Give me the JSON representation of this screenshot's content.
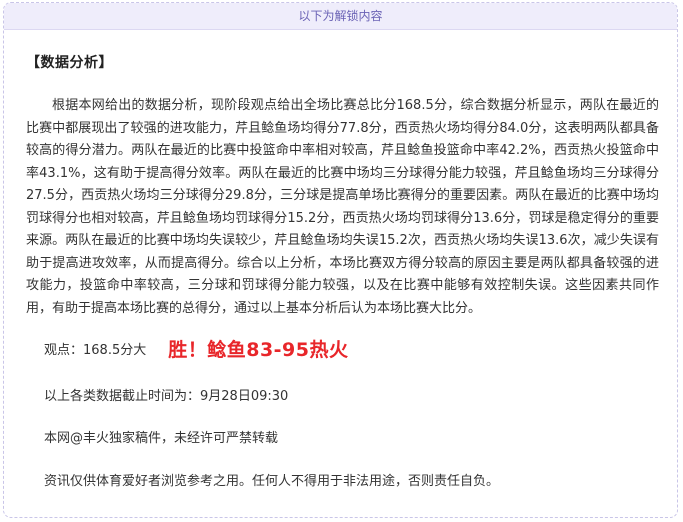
{
  "unlock_banner": "以下为解锁内容",
  "section_title": "【数据分析】",
  "analysis_text": "根据本网给出的数据分析，现阶段观点给出全场比赛总比分168.5分，综合数据分析显示，两队在最近的比赛中都展现出了较强的进攻能力，芹且鲶鱼场均得分77.8分，西贡热火场均得分84.0分，这表明两队都具备较高的得分潜力。两队在最近的比赛中投篮命中率相对较高，芹且鲶鱼投篮命中率42.2%，西贡热火投篮命中率43.1%，这有助于提高得分效率。两队在最近的比赛中场均三分球得分能力较强，芹且鲶鱼场均三分球得分27.5分，西贡热火场均三分球得分29.8分，三分球是提高单场比赛得分的重要因素。两队在最近的比赛中场均罚球得分也相对较高，芹且鲶鱼场均罚球得分15.2分，西贡热火场均罚球得分13.6分，罚球是稳定得分的重要来源。两队在最近的比赛中场均失误较少，芹且鲶鱼场均失误15.2次，西贡热火场均失误13.6次，减少失误有助于提高进攻效率，从而提高得分。综合以上分析，本场比赛双方得分较高的原因主要是两队都具备较强的进攻能力，投篮命中率较高，三分球和罚球得分能力较强，以及在比赛中能够有效控制失误。这些因素共同作用，有助于提高本场比赛的总得分，通过以上基本分析后认为本场比赛大比分。",
  "opinion": "观点：168.5分大",
  "prediction": "胜！鲶鱼83-95热火",
  "deadline": "以上各类数据截止时间为：9月28日09:30",
  "copyright": "本网@丰火独家稿件，未经许可严禁转载",
  "disclaimer": "资讯仅供体育爱好者浏览参考之用。任何人不得用于非法用途，否则责任自负。",
  "colors": {
    "banner_bg": "#efedfb",
    "banner_text": "#6a62b5",
    "frame_border": "#c9c5e8",
    "prediction_red": "#e8262a"
  }
}
